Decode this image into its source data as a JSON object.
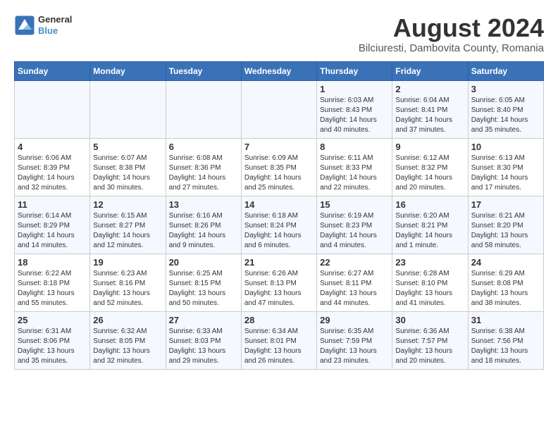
{
  "header": {
    "logo_line1": "General",
    "logo_line2": "Blue",
    "month_year": "August 2024",
    "location": "Bilciuresti, Dambovita County, Romania"
  },
  "weekdays": [
    "Sunday",
    "Monday",
    "Tuesday",
    "Wednesday",
    "Thursday",
    "Friday",
    "Saturday"
  ],
  "weeks": [
    [
      {
        "day": "",
        "info": ""
      },
      {
        "day": "",
        "info": ""
      },
      {
        "day": "",
        "info": ""
      },
      {
        "day": "",
        "info": ""
      },
      {
        "day": "1",
        "info": "Sunrise: 6:03 AM\nSunset: 8:43 PM\nDaylight: 14 hours\nand 40 minutes."
      },
      {
        "day": "2",
        "info": "Sunrise: 6:04 AM\nSunset: 8:41 PM\nDaylight: 14 hours\nand 37 minutes."
      },
      {
        "day": "3",
        "info": "Sunrise: 6:05 AM\nSunset: 8:40 PM\nDaylight: 14 hours\nand 35 minutes."
      }
    ],
    [
      {
        "day": "4",
        "info": "Sunrise: 6:06 AM\nSunset: 8:39 PM\nDaylight: 14 hours\nand 32 minutes."
      },
      {
        "day": "5",
        "info": "Sunrise: 6:07 AM\nSunset: 8:38 PM\nDaylight: 14 hours\nand 30 minutes."
      },
      {
        "day": "6",
        "info": "Sunrise: 6:08 AM\nSunset: 8:36 PM\nDaylight: 14 hours\nand 27 minutes."
      },
      {
        "day": "7",
        "info": "Sunrise: 6:09 AM\nSunset: 8:35 PM\nDaylight: 14 hours\nand 25 minutes."
      },
      {
        "day": "8",
        "info": "Sunrise: 6:11 AM\nSunset: 8:33 PM\nDaylight: 14 hours\nand 22 minutes."
      },
      {
        "day": "9",
        "info": "Sunrise: 6:12 AM\nSunset: 8:32 PM\nDaylight: 14 hours\nand 20 minutes."
      },
      {
        "day": "10",
        "info": "Sunrise: 6:13 AM\nSunset: 8:30 PM\nDaylight: 14 hours\nand 17 minutes."
      }
    ],
    [
      {
        "day": "11",
        "info": "Sunrise: 6:14 AM\nSunset: 8:29 PM\nDaylight: 14 hours\nand 14 minutes."
      },
      {
        "day": "12",
        "info": "Sunrise: 6:15 AM\nSunset: 8:27 PM\nDaylight: 14 hours\nand 12 minutes."
      },
      {
        "day": "13",
        "info": "Sunrise: 6:16 AM\nSunset: 8:26 PM\nDaylight: 14 hours\nand 9 minutes."
      },
      {
        "day": "14",
        "info": "Sunrise: 6:18 AM\nSunset: 8:24 PM\nDaylight: 14 hours\nand 6 minutes."
      },
      {
        "day": "15",
        "info": "Sunrise: 6:19 AM\nSunset: 8:23 PM\nDaylight: 14 hours\nand 4 minutes."
      },
      {
        "day": "16",
        "info": "Sunrise: 6:20 AM\nSunset: 8:21 PM\nDaylight: 14 hours\nand 1 minute."
      },
      {
        "day": "17",
        "info": "Sunrise: 6:21 AM\nSunset: 8:20 PM\nDaylight: 13 hours\nand 58 minutes."
      }
    ],
    [
      {
        "day": "18",
        "info": "Sunrise: 6:22 AM\nSunset: 8:18 PM\nDaylight: 13 hours\nand 55 minutes."
      },
      {
        "day": "19",
        "info": "Sunrise: 6:23 AM\nSunset: 8:16 PM\nDaylight: 13 hours\nand 52 minutes."
      },
      {
        "day": "20",
        "info": "Sunrise: 6:25 AM\nSunset: 8:15 PM\nDaylight: 13 hours\nand 50 minutes."
      },
      {
        "day": "21",
        "info": "Sunrise: 6:26 AM\nSunset: 8:13 PM\nDaylight: 13 hours\nand 47 minutes."
      },
      {
        "day": "22",
        "info": "Sunrise: 6:27 AM\nSunset: 8:11 PM\nDaylight: 13 hours\nand 44 minutes."
      },
      {
        "day": "23",
        "info": "Sunrise: 6:28 AM\nSunset: 8:10 PM\nDaylight: 13 hours\nand 41 minutes."
      },
      {
        "day": "24",
        "info": "Sunrise: 6:29 AM\nSunset: 8:08 PM\nDaylight: 13 hours\nand 38 minutes."
      }
    ],
    [
      {
        "day": "25",
        "info": "Sunrise: 6:31 AM\nSunset: 8:06 PM\nDaylight: 13 hours\nand 35 minutes."
      },
      {
        "day": "26",
        "info": "Sunrise: 6:32 AM\nSunset: 8:05 PM\nDaylight: 13 hours\nand 32 minutes."
      },
      {
        "day": "27",
        "info": "Sunrise: 6:33 AM\nSunset: 8:03 PM\nDaylight: 13 hours\nand 29 minutes."
      },
      {
        "day": "28",
        "info": "Sunrise: 6:34 AM\nSunset: 8:01 PM\nDaylight: 13 hours\nand 26 minutes."
      },
      {
        "day": "29",
        "info": "Sunrise: 6:35 AM\nSunset: 7:59 PM\nDaylight: 13 hours\nand 23 minutes."
      },
      {
        "day": "30",
        "info": "Sunrise: 6:36 AM\nSunset: 7:57 PM\nDaylight: 13 hours\nand 20 minutes."
      },
      {
        "day": "31",
        "info": "Sunrise: 6:38 AM\nSunset: 7:56 PM\nDaylight: 13 hours\nand 18 minutes."
      }
    ]
  ]
}
